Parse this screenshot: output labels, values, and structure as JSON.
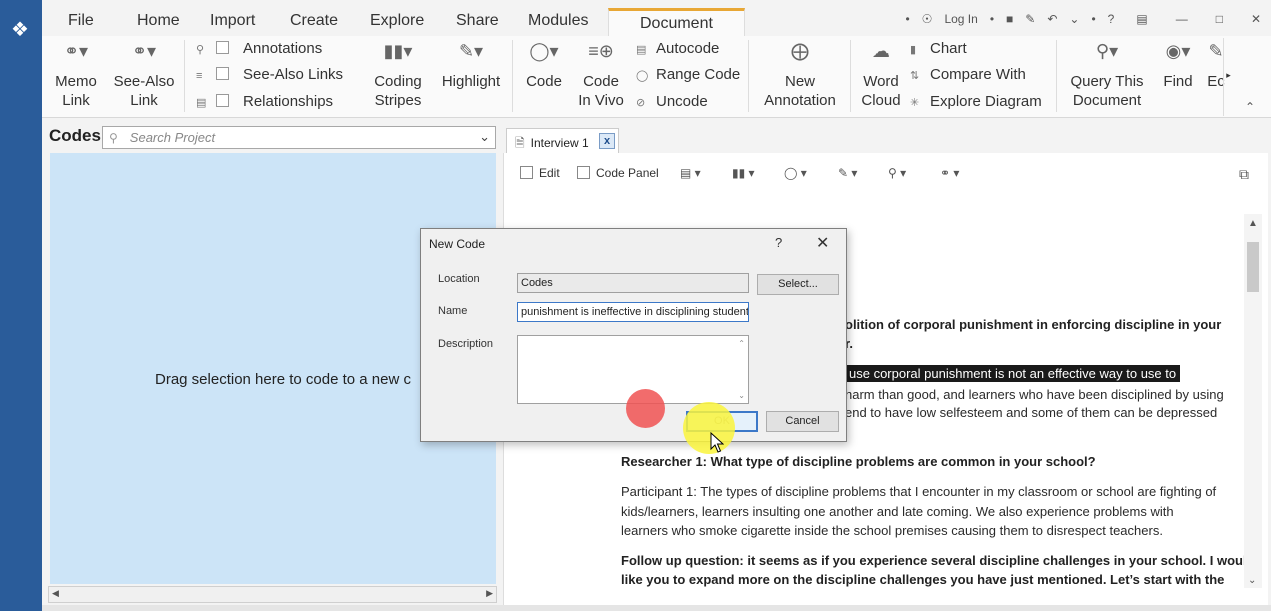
{
  "menu": {
    "tabs": [
      "File",
      "Home",
      "Import",
      "Create",
      "Explore",
      "Share",
      "Modules",
      "Document"
    ],
    "active_tab": "Document",
    "login_label": "Log In",
    "help_label": "?"
  },
  "ribbon": {
    "memo_link": "Memo\nLink",
    "see_also_link": "See-Also\nLink",
    "annotations": "Annotations",
    "see_also_links": "See-Also Links",
    "relationships": "Relationships",
    "coding_stripes": "Coding\nStripes",
    "highlight": "Highlight",
    "code": "Code",
    "code_in_vivo": "Code\nIn Vivo",
    "autocode": "Autocode",
    "range_code": "Range Code",
    "uncode": "Uncode",
    "new_annotation": "New\nAnnotation",
    "word_cloud": "Word\nCloud",
    "chart": "Chart",
    "compare_with": "Compare With",
    "explore_diagram": "Explore Diagram",
    "query_this_document": "Query This\nDocument",
    "find": "Find",
    "edit_partial": "Ec"
  },
  "left_panel": {
    "title": "Codes",
    "search_placeholder": "Search Project",
    "drop_hint": "Drag selection here to code to a new c"
  },
  "document_tab": {
    "label": "Interview 1",
    "close": "x"
  },
  "doc_toolbar": {
    "edit_label": "Edit",
    "code_panel_label": "Code Panel"
  },
  "document": {
    "line1": "olition of corporal punishment in enforcing discipline in your",
    "line2": "r.",
    "line3_highlight": "use corporal punishment is not an effective way to use to",
    "line4": "harm than good, and learners who have been disciplined by using",
    "line5": "end to have low selfesteem and some of them can be depressed",
    "q2": "Researcher 1: What type of discipline problems are common in your school?",
    "p2_1": "Participant 1: The types of discipline problems that I encounter in my classroom or school are fighting of",
    "p2_2": "kids/learners, learners insulting one another and late coming. We also experience problems with",
    "p2_3": "learners who smoke cigarette inside the school premises causing them to disrespect teachers.",
    "fq_1": "Follow up question: it seems as if you experience several discipline challenges in your school. I would",
    "fq_2": "like you to expand more on the discipline challenges you have just mentioned. Let’s start with the"
  },
  "dialog": {
    "title": "New Code",
    "help": "?",
    "location_label": "Location",
    "location_value": "Codes",
    "select_button": "Select...",
    "name_label": "Name",
    "name_value": "punishment is ineffective in disciplining students",
    "description_label": "Description",
    "ok_button": "OK",
    "cancel_button": "Cancel"
  },
  "colors": {
    "accent_tab": "#e8a735",
    "left_strip": "#2a5c9a",
    "drop_area": "#cce4f7",
    "highlight_bg": "#1a1a1a"
  }
}
